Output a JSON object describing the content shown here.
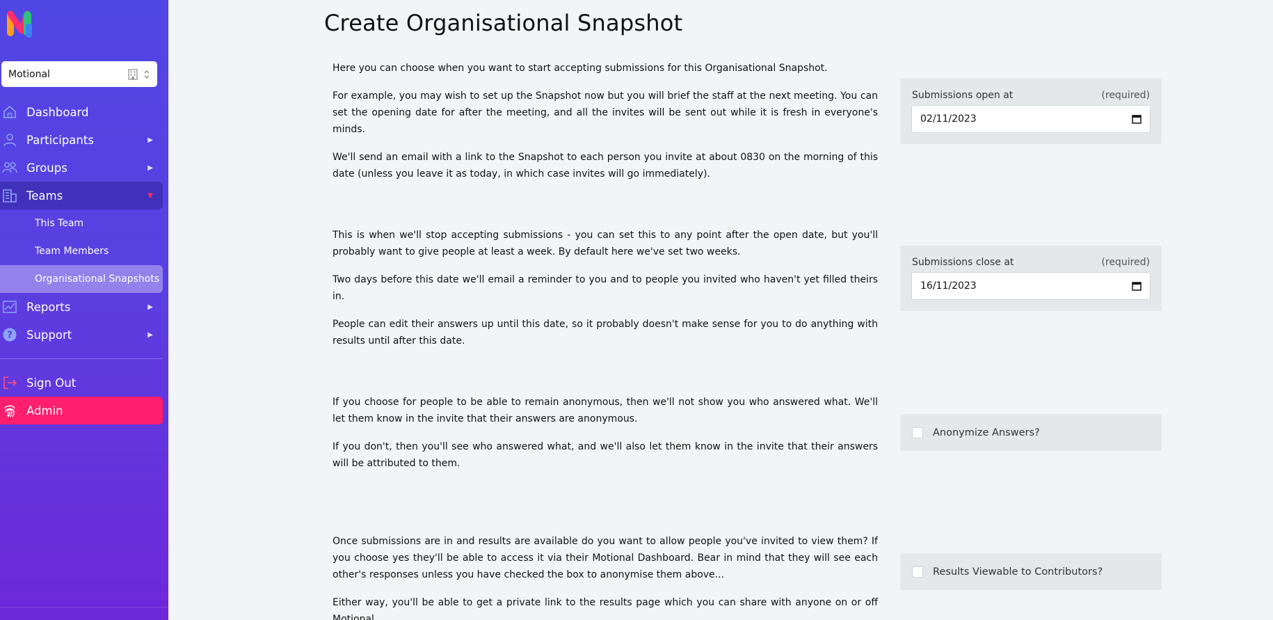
{
  "sidebar": {
    "team_select": "Motional",
    "nav": {
      "dashboard": "Dashboard",
      "participants": "Participants",
      "groups": "Groups",
      "teams": "Teams",
      "teams_sub": [
        "This Team",
        "Team Members",
        "Organisational Snapshots"
      ],
      "reports": "Reports",
      "support": "Support",
      "sign_out": "Sign Out",
      "admin": "Admin"
    }
  },
  "main": {
    "title": "Create Organisational Snapshot",
    "open_section": {
      "paragraphs": [
        "Here you can choose when you want to start accepting submissions for this Organisational Snapshot.",
        "For example, you may wish to set up the Snapshot now but you will brief the staff at the next meeting. You can set the opening date for after the meeting, and all the invites will be sent out while it is fresh in everyone's minds.",
        "We'll send an email with a link to the Snapshot to each person you invite at about 0830 on the morning of this date (unless you leave it as today, in which case invites will go immediately)."
      ],
      "label": "Submissions open at",
      "required": "(required)",
      "value": "02/11/2023"
    },
    "close_section": {
      "paragraphs": [
        "This is when we'll stop accepting submissions - you can set this to any point after the open date, but you'll probably want to give people at least a week. By default here we've set two weeks.",
        "Two days before this date we'll email a reminder to you and to people you invited who haven't yet filled theirs in.",
        "People can edit their answers up until this date, so it probably doesn't make sense for you to do anything with results until after this date."
      ],
      "label": "Submissions close at",
      "required": "(required)",
      "value": "16/11/2023"
    },
    "anon_section": {
      "paragraphs": [
        "If you choose for people to be able to remain anonymous, then we'll not show you who answered what. We'll let them know in the invite that their answers are anonymous.",
        "If you don't, then you'll see who answered what, and we'll also let them know in the invite that their answers will be attributed to them."
      ],
      "checkbox_label": "Anonymize Answers?"
    },
    "results_section": {
      "paragraphs": [
        "Once submissions are in and results are available do you want to allow people you've invited to view them? If you choose yes they'll be able to access it via their Motional Dashboard. Bear in mind that they will see each other's responses unless you have checked the box to anonymise them above...",
        "Either way, you'll be able to get a private link to the results page which you can share with anyone on or off Motional."
      ],
      "checkbox_label": "Results Viewable to Contributors?"
    }
  },
  "colors": {
    "sidebar_top": "#5046e4",
    "sidebar_bottom": "#6d28d9",
    "admin": "#ff1f6c",
    "background": "#f3f4f6"
  }
}
